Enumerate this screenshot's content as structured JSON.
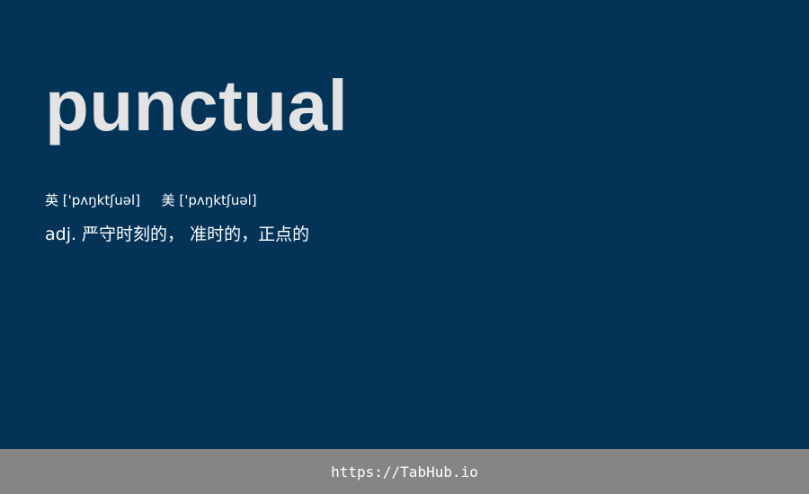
{
  "word": "punctual",
  "phonetics": {
    "uk_label": "英",
    "uk": "['pʌŋktʃuəl]",
    "us_label": "美",
    "us": "['pʌŋktʃuəl]"
  },
  "definition": "adj. 严守时刻的， 准时的，正点的",
  "footer": {
    "link": "https://TabHub.io"
  },
  "colors": {
    "background": "#033457",
    "footer_background": "#858585",
    "word_text": "#e3e3e3",
    "text": "#ffffff"
  }
}
